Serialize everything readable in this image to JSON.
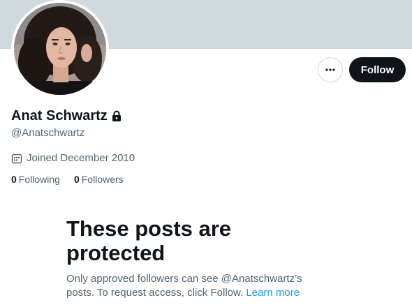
{
  "profile": {
    "display_name": "Anat Schwartz",
    "handle": "@Anatschwartz",
    "joined": "Joined December 2010",
    "following_count": "0",
    "following_label": "Following",
    "followers_count": "0",
    "followers_label": "Followers",
    "lock_icon": "lock-icon",
    "calendar_icon": "calendar-icon"
  },
  "actions": {
    "more_icon": "more-horizontal-icon",
    "follow_label": "Follow"
  },
  "protected_notice": {
    "title": "These posts are protected",
    "description": "Only approved followers can see @Anatschwartz’s posts. To request access, click Follow.",
    "learn_more": "Learn more"
  },
  "colors": {
    "banner": "#cfd9de",
    "text_primary": "#0f1419",
    "text_secondary": "#536471",
    "link": "#1d9bf0",
    "follow_bg": "#0f1419"
  }
}
